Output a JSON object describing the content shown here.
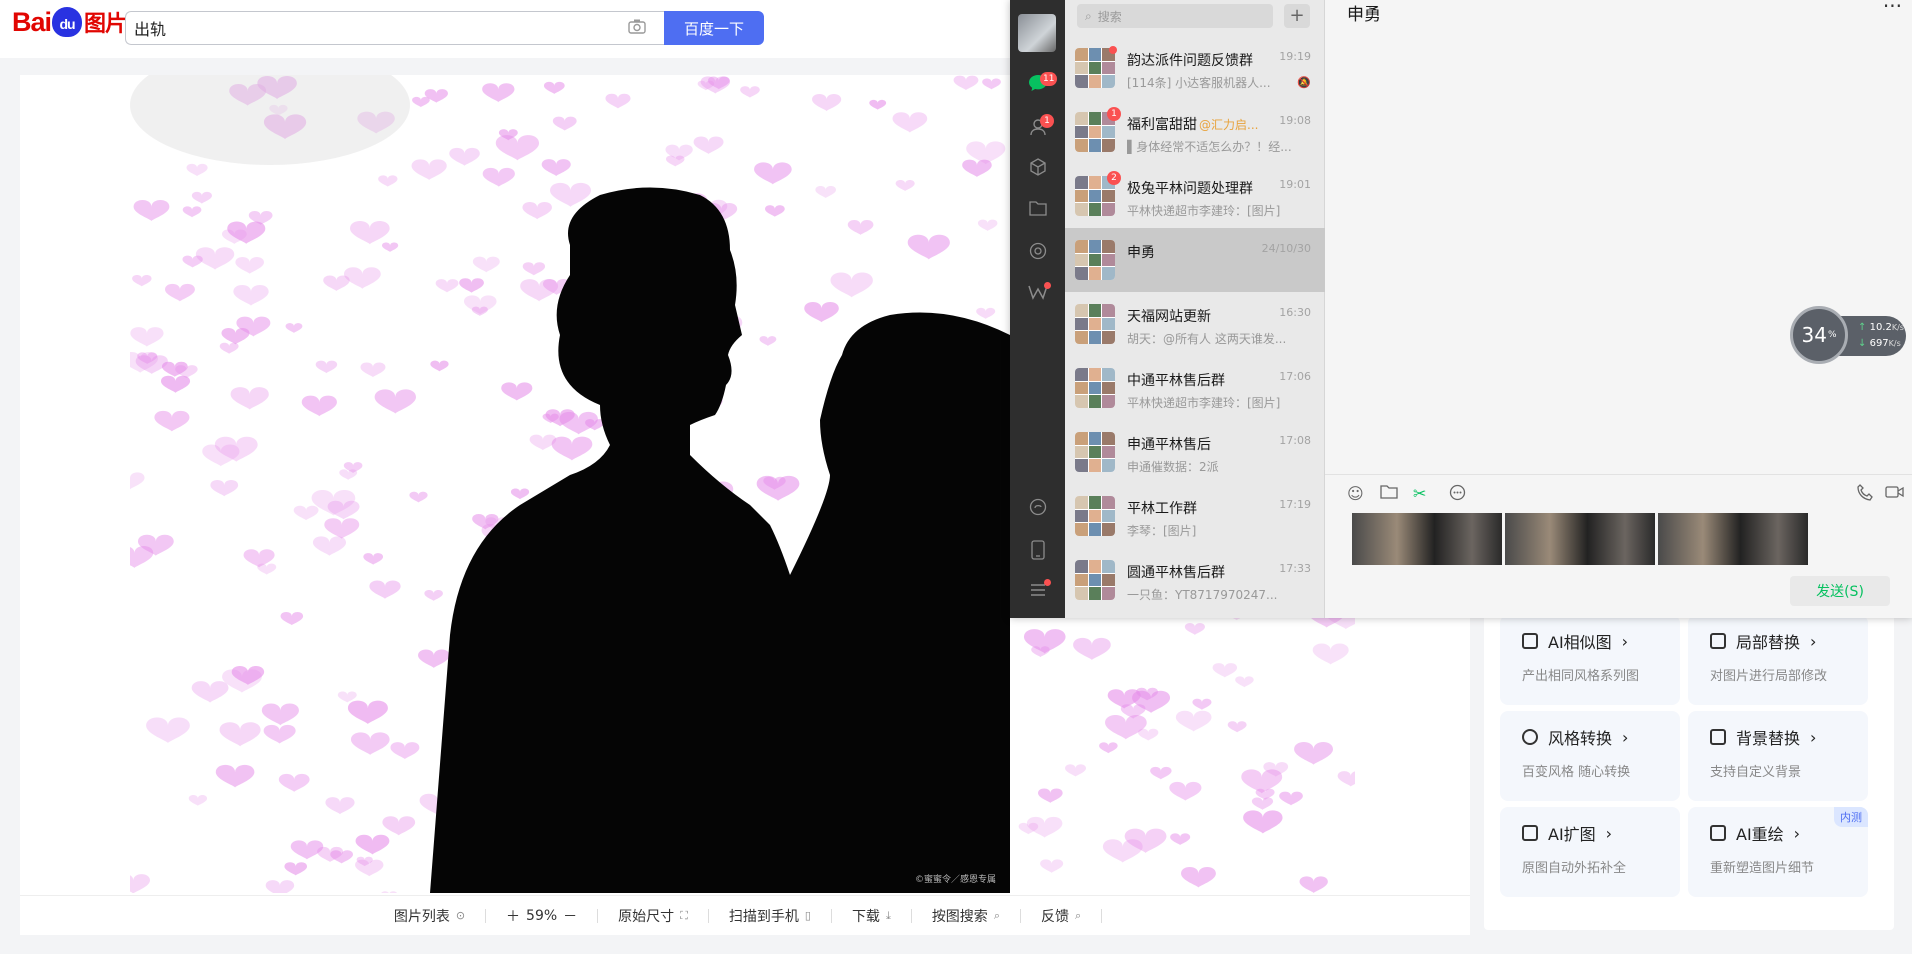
{
  "baidu": {
    "logo_bai": "Bai",
    "logo_du": "du",
    "logo_img": "图片",
    "search_value": "出轨",
    "search_button": "百度一下",
    "watermark": "©蜜蜜令／感恩专属"
  },
  "toolbar": {
    "image_list": "图片列表",
    "zoom": "59%",
    "original_size": "原始尺寸",
    "scan_to_phone": "扫描到手机",
    "download": "下载",
    "image_search": "按图搜索",
    "feedback": "反馈"
  },
  "features": [
    {
      "title": "AI相似图",
      "desc": "产出相同风格系列图",
      "icon": "similar-icon"
    },
    {
      "title": "局部替换",
      "desc": "对图片进行局部修改",
      "icon": "replace-icon"
    },
    {
      "title": "风格转换",
      "desc": "百变风格 随心转换",
      "icon": "style-icon"
    },
    {
      "title": "背景替换",
      "desc": "支持自定义背景",
      "icon": "background-icon"
    },
    {
      "title": "AI扩图",
      "desc": "原图自动外拓补全",
      "icon": "expand-icon"
    },
    {
      "title": "AI重绘",
      "desc": "重新塑造图片细节",
      "icon": "redraw-icon",
      "badge": "内测"
    }
  ],
  "wechat": {
    "search_placeholder": "搜索",
    "chat_badge": "11",
    "contacts_badge": "1",
    "current_chat": "申勇",
    "send_label": "发送(S)",
    "conversations": [
      {
        "name": "韵达派件问题反馈群",
        "time": "19:19",
        "msg": "[114条] 小达客服机器人...",
        "dot": true,
        "muted": true
      },
      {
        "name": "福利富甜甜",
        "at": "@汇力启...",
        "time": "19:08",
        "msg": "▌身体经常不适怎么办？！经...",
        "badge": "1"
      },
      {
        "name": "极兔平林问题处理群",
        "time": "19:01",
        "msg": "平林快递超市李建玲：[图片]",
        "badge": "2"
      },
      {
        "name": "申勇",
        "time": "24/10/30",
        "msg": "",
        "selected": true
      },
      {
        "name": "天福网站更新",
        "time": "16:30",
        "msg": "胡天：@所有人 这两天谁发..."
      },
      {
        "name": "中通平林售后群",
        "time": "17:06",
        "msg": "平林快递超市李建玲：[图片]"
      },
      {
        "name": "申通平林售后",
        "time": "17:08",
        "msg": "申通催数据：2派"
      },
      {
        "name": "平林工作群",
        "time": "17:19",
        "msg": "李琴：[图片]"
      },
      {
        "name": "圆通平林售后群",
        "time": "17:33",
        "msg": "一只鱼：YT8717970247..."
      }
    ]
  },
  "network": {
    "percent": "34",
    "percent_unit": "%",
    "upload": "10.2",
    "download": "697",
    "unit": "K/s"
  }
}
